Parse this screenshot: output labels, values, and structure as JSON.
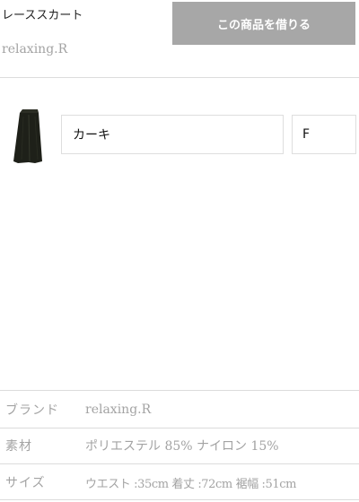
{
  "product": {
    "name": "レーススカート",
    "brand": "relaxing.R"
  },
  "actions": {
    "rent_label": "この商品を借りる"
  },
  "variant": {
    "thumbnail_icon": "skirt-thumbnail",
    "color": "カーキ",
    "size": "F"
  },
  "specs": [
    {
      "label": "ブランド",
      "value": "relaxing.R"
    },
    {
      "label": "素材",
      "value": "ポリエステル 85% ナイロン 15%"
    },
    {
      "label": "サイズ",
      "value": "ウエスト :35cm 着丈 :72cm 裾幅 :51cm"
    }
  ],
  "colors": {
    "button_bg": "#a7a7a7",
    "muted_text": "#a3a3a3",
    "divider": "#dcdcdc"
  }
}
